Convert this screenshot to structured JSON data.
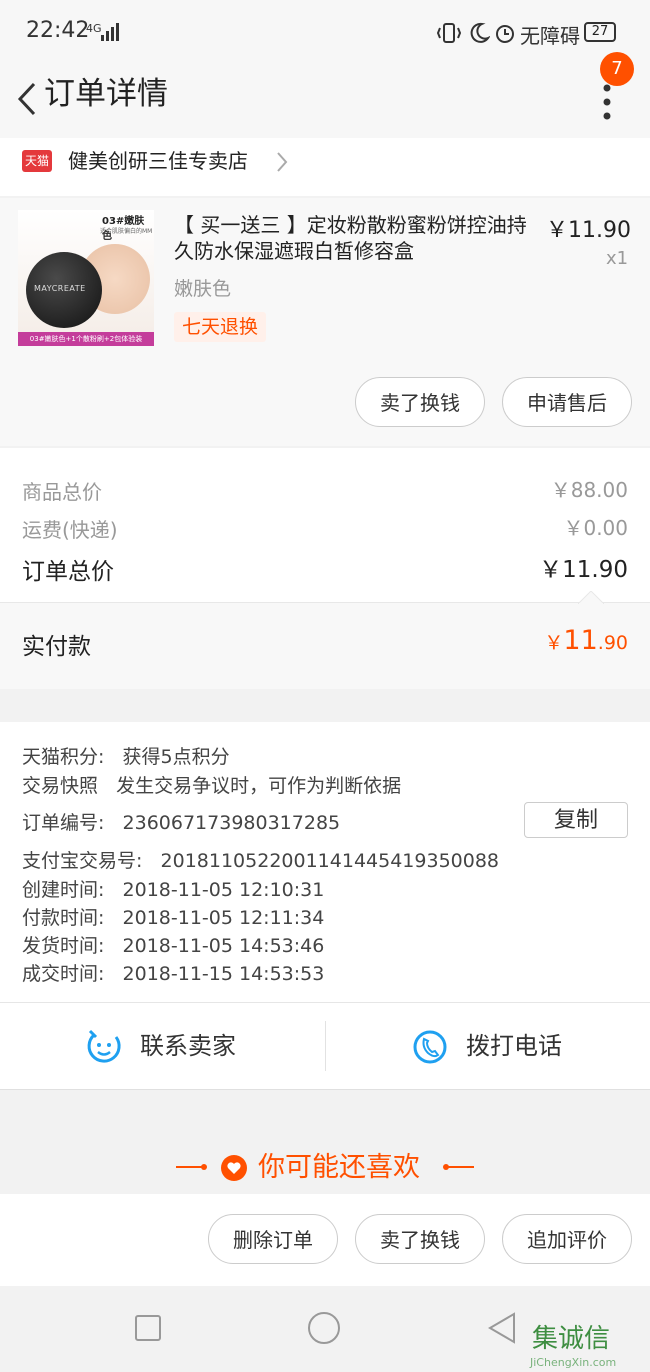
{
  "status": {
    "time": "22:42",
    "network": "4G",
    "accessibility": "无障碍",
    "battery": "27"
  },
  "header": {
    "title": "订单详情",
    "notification_count": "7"
  },
  "shop": {
    "platform_tag": "天猫",
    "name": "健美创研三佳专卖店"
  },
  "product": {
    "name": "【 买一送三 】定妆粉散粉蜜粉饼控油持久防水保湿遮瑕白皙修容盒",
    "price": "￥11.90",
    "qty": "x1",
    "sku": "嫩肤色",
    "tag": "七天退换",
    "image_label_top": "03#嫩肤色",
    "image_label_sub": "适合肌肤偏白的MM",
    "image_brand": "MAYCREATE",
    "image_caption": "03#嫩肤色+1个散粉刷+2包体验装",
    "buttons": [
      "卖了换钱",
      "申请售后"
    ]
  },
  "prices": {
    "rows": [
      {
        "label": "商品总价",
        "value": "￥88.00"
      },
      {
        "label": "运费(快递)",
        "value": "￥0.00"
      }
    ],
    "total_label": "订单总价",
    "total_value": "￥11.90",
    "paid_label": "实付款",
    "paid_symbol": "￥",
    "paid_int": "11",
    "paid_dec": ".90"
  },
  "info": {
    "tmall_points_label": "天猫积分:",
    "tmall_points_value": "获得5点积分",
    "snapshot_label": "交易快照",
    "snapshot_value": "发生交易争议时，可作为判断依据",
    "order_no_label": "订单编号:",
    "order_no": "236067173980317285",
    "copy_label": "复制",
    "alipay_label": "支付宝交易号:",
    "alipay_no": "2018110522001141445419350088",
    "times": [
      {
        "label": "创建时间:",
        "value": "2018-11-05 12:10:31"
      },
      {
        "label": "付款时间:",
        "value": "2018-11-05 12:11:34"
      },
      {
        "label": "发货时间:",
        "value": "2018-11-05 14:53:46"
      },
      {
        "label": "成交时间:",
        "value": "2018-11-15 14:53:53"
      }
    ]
  },
  "contact": {
    "seller": "联系卖家",
    "phone": "拨打电话"
  },
  "recommend": {
    "title": "你可能还喜欢"
  },
  "actions": {
    "buttons": [
      "删除订单",
      "卖了换钱",
      "追加评价"
    ]
  },
  "watermark": {
    "text": "集诚信",
    "url": "JiChengXin.com"
  },
  "colors": {
    "accent": "#ff5000",
    "blue": "#1fa0f0",
    "tmall": "#e4393c"
  }
}
